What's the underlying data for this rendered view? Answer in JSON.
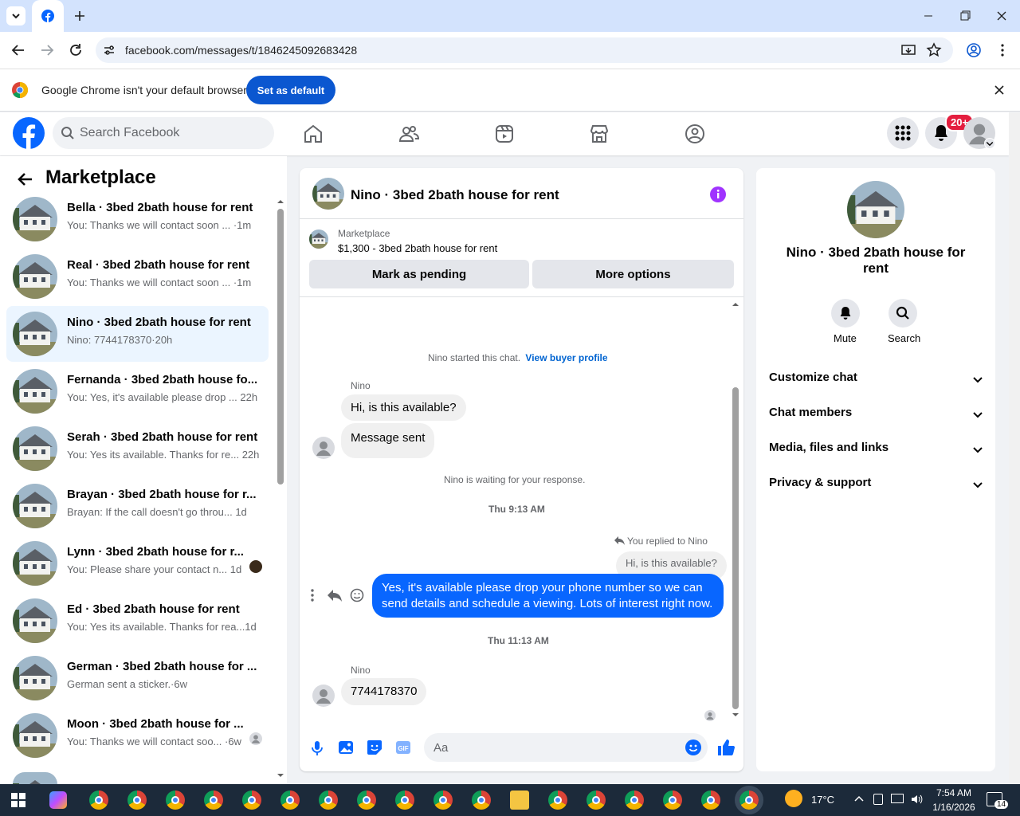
{
  "browser": {
    "url": "facebook.com/messages/t/1846245092683428",
    "infobar_text": "Google Chrome isn't your default browser",
    "set_default_label": "Set as default"
  },
  "fb": {
    "search_placeholder": "Search Facebook",
    "notif_badge": "20+"
  },
  "left": {
    "title": "Marketplace",
    "conversations": [
      {
        "title": "Bella · 3bed 2bath house for rent",
        "preview": "You: Thanks we will contact soon ... ·1m"
      },
      {
        "title": "Real · 3bed 2bath house for rent",
        "preview": "You: Thanks we will contact soon ... ·1m"
      },
      {
        "title": "Nino · 3bed 2bath house for rent",
        "preview": "Nino: 7744178370·20h"
      },
      {
        "title": "Fernanda · 3bed 2bath house fo...",
        "preview": "You: Yes, it's available please drop ... 22h"
      },
      {
        "title": "Serah · 3bed 2bath house for rent",
        "preview": "You: Yes its available. Thanks for re... 22h"
      },
      {
        "title": "Brayan · 3bed 2bath house for r...",
        "preview": "Brayan: If the call doesn't go throu...   1d"
      },
      {
        "title": "Lynn · 3bed 2bath house for r...",
        "preview": "You: Please share your contact n...  1d"
      },
      {
        "title": "Ed · 3bed 2bath house for rent",
        "preview": "You: Yes its available. Thanks for rea...1d"
      },
      {
        "title": "German · 3bed 2bath house for ...",
        "preview": "German sent a sticker.·6w"
      },
      {
        "title": "Moon · 3bed 2bath house for ...",
        "preview": "You: Thanks we will contact soo... ·6w"
      }
    ]
  },
  "chat": {
    "title": "Nino · 3bed 2bath house for rent",
    "listing_label": "Marketplace",
    "listing_detail": "$1,300 - 3bed 2bath house for rent",
    "mark_pending": "Mark as pending",
    "more_options": "More options",
    "started_text": "Nino started this chat.",
    "view_profile": "View buyer profile",
    "sender_name": "Nino",
    "msg1": "Hi, is this available?",
    "msg2": "Message sent",
    "waiting": "Nino is waiting for your response.",
    "time1": "Thu 9:13 AM",
    "replied_to": "You replied to Nino",
    "quoted": "Hi, is this available?",
    "my_msg_line1": "Yes, it's available please drop your phone number so we can",
    "my_msg_line2": "send details and schedule a viewing. Lots of interest right now.",
    "time2": "Thu 11:13 AM",
    "sender_name2": "Nino",
    "msg3": "7744178370",
    "composer_placeholder": "Aa"
  },
  "right": {
    "name": "Nino · 3bed 2bath house for rent",
    "mute": "Mute",
    "search": "Search",
    "sections": [
      "Customize chat",
      "Chat members",
      "Media, files and links",
      "Privacy & support"
    ]
  },
  "taskbar": {
    "temp": "17°C",
    "time": "7:54 AM",
    "date": "1/16/2026",
    "notif_count": "14"
  },
  "colors": {
    "fb_blue": "#0866ff",
    "chrome_blue": "#0b57d0",
    "badge_red": "#e41e3f",
    "info_purple": "#a033ff"
  }
}
